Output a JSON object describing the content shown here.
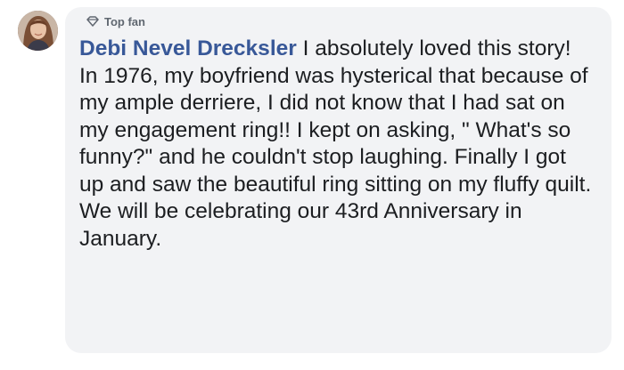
{
  "comment": {
    "badge_label": "Top fan",
    "author": "Debi Nevel Drecksler",
    "first_line": " I absolutely loved this story!",
    "body": "In 1976, my boyfriend was hysterical that because of my ample derriere, I did not know that I had sat on my engagement ring!! I kept on asking, \" What's so funny?\" and he couldn't stop laughing. Finally I got up and saw the beautiful ring sitting on my fluffy quilt. We will be celebrating our 43rd Anniversary in January."
  },
  "colors": {
    "author_link": "#385898",
    "bubble_bg": "#f2f3f5",
    "text": "#1c1e21",
    "badge_text": "#606770"
  },
  "icons": {
    "badge": "diamond-icon",
    "avatar": "profile-photo"
  }
}
